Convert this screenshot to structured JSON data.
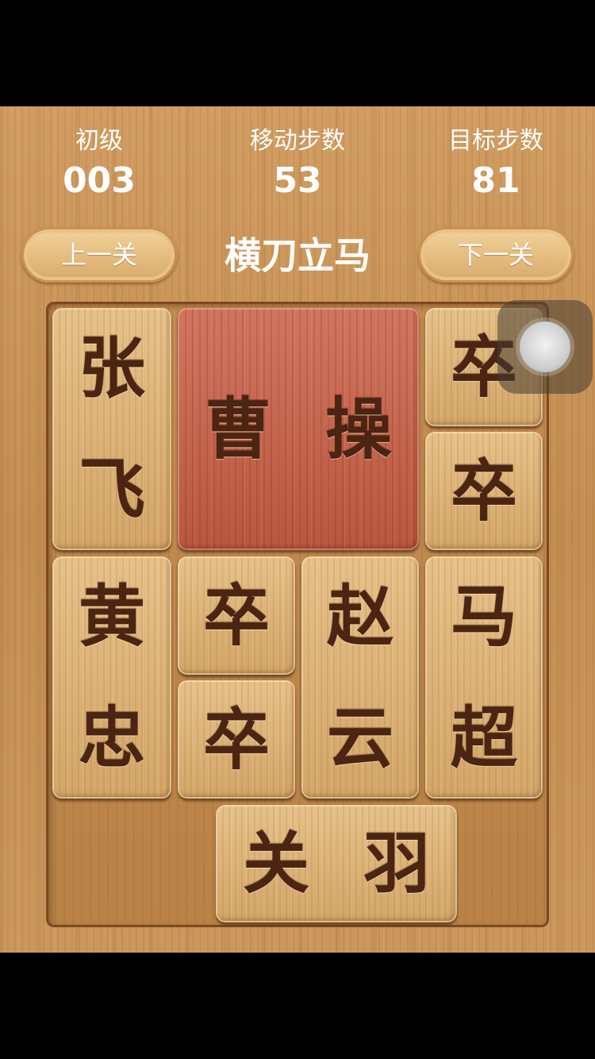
{
  "header": {
    "difficulty_label": "初级",
    "level_number": "003",
    "moves_label": "移动步数",
    "moves_value": "53",
    "target_label": "目标步数",
    "target_value": "81"
  },
  "nav": {
    "prev_label": "上一关",
    "next_label": "下一关",
    "level_name": "横刀立马"
  },
  "board": {
    "pieces": [
      {
        "name": "张飞",
        "chars": [
          "张",
          "飞"
        ]
      },
      {
        "name": "曹操",
        "chars": [
          "曹",
          "操"
        ]
      },
      {
        "name": "卒1",
        "chars": [
          "卒"
        ]
      },
      {
        "name": "卒2",
        "chars": [
          "卒"
        ]
      },
      {
        "name": "黄忠",
        "chars": [
          "黄",
          "忠"
        ]
      },
      {
        "name": "卒3",
        "chars": [
          "卒"
        ]
      },
      {
        "name": "赵云",
        "chars": [
          "赵",
          "云"
        ]
      },
      {
        "name": "马超",
        "chars": [
          "马",
          "超"
        ]
      },
      {
        "name": "卒4",
        "chars": [
          "卒"
        ]
      },
      {
        "name": "关羽",
        "chars": [
          "关",
          "羽"
        ]
      }
    ]
  },
  "colors": {
    "wood": "#c9955a",
    "tile": "#ddb47a",
    "cao_cao_tile": "#c0604a",
    "glyph": "#4b2412"
  },
  "icons": {
    "assistive_touch": "assistive-touch-icon"
  }
}
